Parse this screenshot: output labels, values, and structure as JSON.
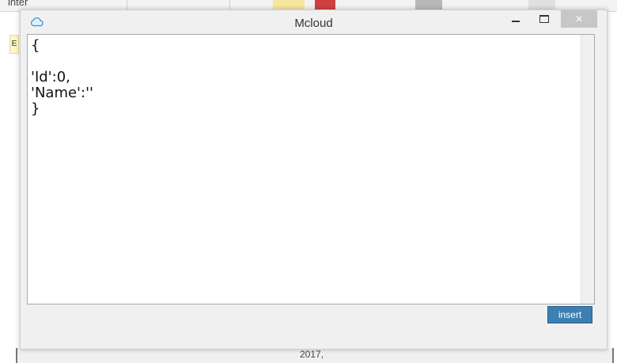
{
  "background": {
    "top_label": "inter",
    "left_tab_label": "E",
    "bottom_text": "2017,"
  },
  "window": {
    "title": "Mcloud",
    "icon": "cloud-icon",
    "controls": {
      "minimize_icon": "minimize-icon",
      "maximize_icon": "maximize-icon",
      "close_label": "✕"
    }
  },
  "editor": {
    "content": "{\n\n'Id':0,\n'Name':''\n}"
  },
  "insert_button": {
    "label": "insert"
  },
  "colors": {
    "accent_button": "#3c7fb1",
    "close_button_bg": "#c7c7c7"
  }
}
